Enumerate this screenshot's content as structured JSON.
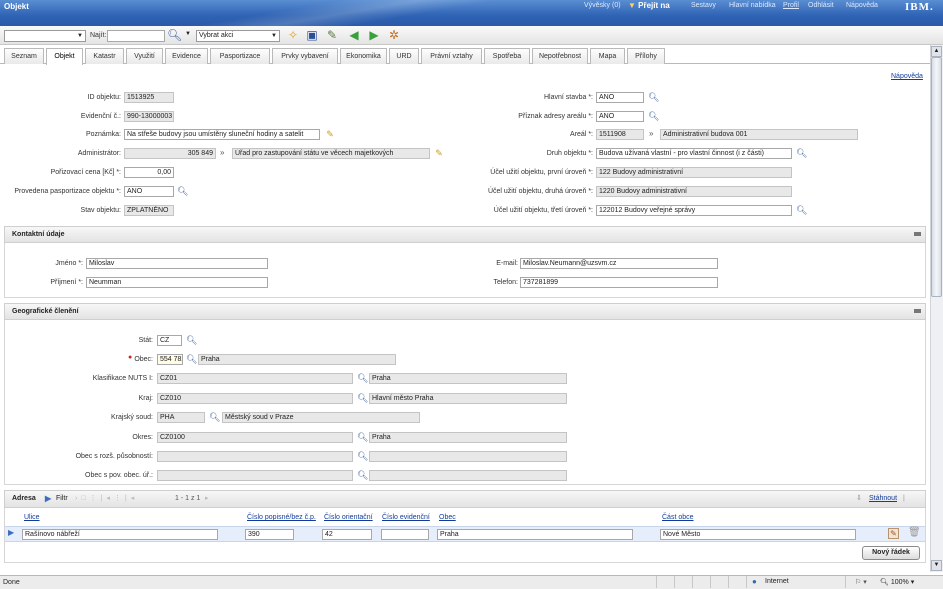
{
  "window": {
    "title": "Objekt"
  },
  "topnav": {
    "vyvesky": "Vývěsky (0)",
    "goto": "Přejít na",
    "sestavy": "Sestavy",
    "hlavni": "Hlavní nabídka",
    "profil": "Profil",
    "odhlasit": "Odhlásit",
    "napoveda": "Nápověda",
    "brand": "IBM."
  },
  "toolbar": {
    "find_label": "Najít:",
    "find_value": "",
    "action_select": "Vybrat akci"
  },
  "tabs": [
    "Seznam",
    "Objekt",
    "Katastr",
    "Využití",
    "Evidence",
    "Pasportizace",
    "Prvky vybavení",
    "Ekonomika",
    "URD",
    "Právní vztahy",
    "Spotřeba",
    "Nepotřebnost",
    "Mapa",
    "Přílohy"
  ],
  "help_link": "Nápověda",
  "object": {
    "id_label": "ID objektu:",
    "id_value": "1513925",
    "ev_label": "Evidenční č.:",
    "ev_value": "990-13000003",
    "note_label": "Poznámka:",
    "note_value": "Na střeše budovy jsou umístěny sluneční hodiny a satelit",
    "admin_label": "Administrátor:",
    "admin_code": "305 849",
    "admin_name": "Úřad pro zastupování státu ve věcech majetkových",
    "price_label": "Pořizovací cena [Kč] *:",
    "price_value": "0,00",
    "pasp_label": "Provedena pasportizace objektu *:",
    "pasp_value": "ANO",
    "state_label": "Stav objektu:",
    "state_value": "ZPLATNĚNO",
    "main_label": "Hlavní stavba *:",
    "main_value": "ANO",
    "areal_flag_label": "Příznak adresy areálu *:",
    "areal_flag_value": "ANO",
    "areal_label": "Areál *:",
    "areal_code": "1511908",
    "areal_name": "Administrativní budova 001",
    "kind_label": "Druh objektu *:",
    "kind_value": "Budova užívaná vlastní - pro vlastní činnost (i z části)",
    "use1_label": "Účel užití objektu, první úroveň *:",
    "use1_value": "122 Budovy administrativní",
    "use2_label": "Účel užití objektu, druhá úroveň *:",
    "use2_value": "1220 Budovy administrativní",
    "use3_label": "Účel užití objektu, třetí úroveň *:",
    "use3_value": "122012 Budovy veřejné správy"
  },
  "contact": {
    "title": "Kontaktní údaje",
    "first_label": "Jméno *:",
    "first_value": "Miloslav",
    "last_label": "Příjmení *:",
    "last_value": "Neumman",
    "email_label": "E-mail:",
    "email_value": "Miloslav.Neumann@uzsvm.cz",
    "phone_label": "Telefon:",
    "phone_value": "737281899"
  },
  "geo": {
    "title": "Geografické členění",
    "stat_label": "Stát:",
    "stat_value": "CZ",
    "obec_label": "Obec:",
    "obec_code": "554 782",
    "obec_name": "Praha",
    "nuts_label": "Klasifikace NUTS I:",
    "nuts_code": "CZ01",
    "nuts_name": "Praha",
    "kraj_label": "Kraj:",
    "kraj_code": "CZ010",
    "kraj_name": "Hlavní město Praha",
    "soud_label": "Krajský soud:",
    "soud_code": "PHA",
    "soud_name": "Městský soud v Praze",
    "okres_label": "Okres:",
    "okres_code": "CZ0100",
    "okres_name": "Praha",
    "orp_label": "Obec s rozš. působností:",
    "pou_label": "Obec s pov. obec. úř.:"
  },
  "address": {
    "title": "Adresa",
    "filter": "Filtr",
    "pager": "1 - 1 z 1",
    "download": "Stáhnout",
    "headers": [
      "Ulice",
      "Číslo popisné/bez č.p.",
      "Číslo orientační",
      "Číslo evidenční",
      "Obec",
      "Část obce"
    ],
    "row": [
      "Rašínovo nábřeží",
      "390",
      "42",
      "",
      "Praha",
      "Nové Město"
    ],
    "new_row": "Nový řádek"
  },
  "status": {
    "left": "Done",
    "zone": "Internet",
    "zoom": "100%"
  }
}
